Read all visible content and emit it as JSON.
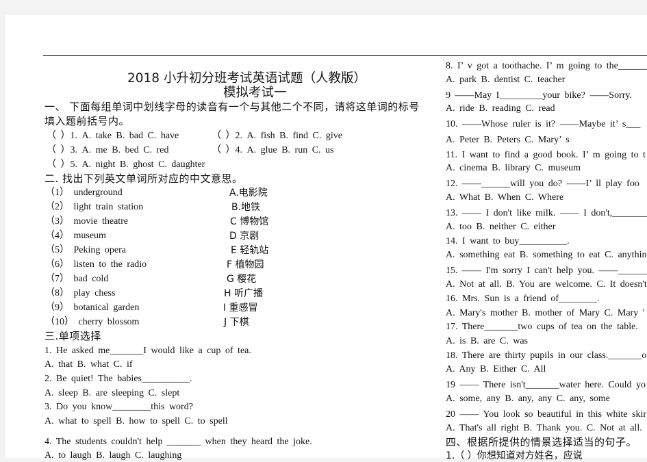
{
  "document": {
    "title_line1": "2018 小升初分班考试英语试题（人教版）",
    "title_line2": "模拟考试一"
  },
  "section1": {
    "heading_line1": "一、 下面每组单词中划线字母的读音有一个与其他二个不同，请将这单词的标号",
    "heading_line2": "填入题前括号内。",
    "items": [
      "（ ）1. A. take B. bad C. have",
      "（ ）2. A. fish B. find C. give",
      "（ ）3. A. me B. bed C. red",
      "（ ）4. A. glue B. run C. us",
      "（ ）5. A. night B. ghost C. daughter"
    ]
  },
  "section2": {
    "heading": "二. 找出下列英文单词所对应的中文意思。",
    "english": [
      "（1） underground",
      "（2） light train station",
      "（3） movie theatre",
      "（4） museum",
      "（5） Peking opera",
      "（6） listen to the radio",
      "（7） bad cold",
      "（8） play chess",
      "（9） botanical garden",
      "（10） cherry blossom"
    ],
    "chinese": [
      "A.电影院",
      "B.地铁",
      "C 博物馆",
      "D 京剧",
      "E 轻轨站",
      "F 植物园",
      "G 樱花",
      "H 听广播",
      "I 重感冒",
      "J 下棋"
    ]
  },
  "section3": {
    "heading": "三.单项选择",
    "left_lines": [
      "1. He asked me_______I would like a cup of tea.",
      "A. that B. what C. if",
      "2. Be quiet! The babies__________.",
      "A. sleep B. are sleeping C. slept",
      "3. Do you know________this word?",
      "A. what to spell B. how to spell C. to spell",
      "4. The students couldn't help _______ when they heard the joke.",
      "A. to laugh B. laugh C. laughing"
    ],
    "right_lines": [
      "8. I’ v got a toothache. I’ m going to the______",
      "A. park B. dentist C. teacher",
      "9 ——May I_________your bike? ——Sorry.",
      "A. ride B. reading C. read",
      "10. ——Whose ruler is it? ——Maybe it’ s___",
      "A. Peter B. Peters C. Mary’ s",
      "11. I want to find a good book. I’ m going to t",
      "A. cinema B. library C. museum",
      "12. ——______will you do? ——I’ ll play foo",
      "A. What B. When C. Where",
      "13. —— I don't like milk. —— I don't,_________",
      "A. too B. neither C. either",
      "14. I want to buy__________.",
      "A. something eat B. something to eat C. anythin",
      "15. —— I'm sorry I can't help you. ——________",
      "A. Not at all. B. You are welcome. C. It doesn't",
      "16. Mrs. Sun is a friend of________.",
      "A. Mary's mother B. mother of Mary C. Mary '",
      "17. There_______two cups of tea on the table.",
      "A. is B. are C. was",
      "18. There are thirty pupils in our class._______o",
      "A. Any B. Either C. All",
      "19 —— There isn't_______water here. Could yo",
      "A. some, any B. any, any C. any, some",
      "20 —— You look so beautiful in this white skir",
      "A. That's all right B. Thank you. C. Not at all."
    ]
  },
  "section4": {
    "heading": "四、根据所提供的情景选择适当的句子。",
    "first_item": "1.（ ）你想知道对方姓名，应说"
  }
}
